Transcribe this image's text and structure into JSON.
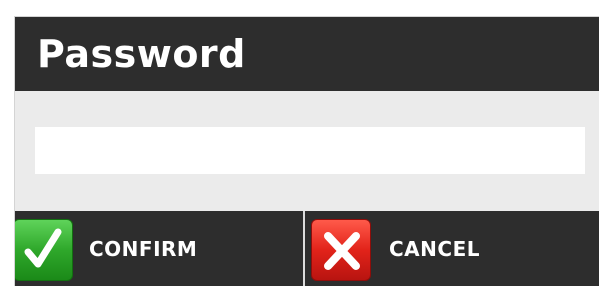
{
  "dialog": {
    "title": "Password",
    "password_field": {
      "value": "",
      "placeholder": ""
    },
    "buttons": {
      "confirm": {
        "label": "CONFIRM",
        "icon": "checkmark-icon",
        "icon_color": "#2fa82b"
      },
      "cancel": {
        "label": "CANCEL",
        "icon": "close-icon",
        "icon_color": "#e2231a"
      }
    },
    "colors": {
      "bar_background": "#2d2d2d",
      "body_background": "#ebebeb",
      "text": "#ffffff"
    }
  }
}
